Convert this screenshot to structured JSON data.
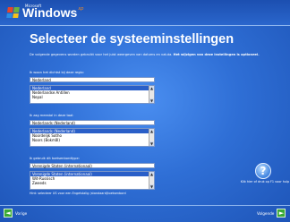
{
  "brand": {
    "ms": "Microsoft",
    "windows": "Windows",
    "xp": "xp"
  },
  "page": {
    "title": "Selecteer de systeeminstellingen",
    "intro_normal": "De volgende gegevens worden gebruikt voor het juist weergeven van datums en valuta.",
    "intro_bold": "Het wijzigen van deze instellingen is optioneel."
  },
  "region": {
    "label": "Ik woon het dichtst bij deze regio:",
    "value": "Nederland",
    "options": [
      "Nederland",
      "Nederlandse Antillen",
      "Nepal"
    ]
  },
  "language": {
    "label": "Ik zag meestal in deze taal:",
    "value": "Nederlands (Nederland)",
    "options": [
      "Nederlands (Nederland)",
      "Noordelijk Sotho",
      "Noors (Bokmål)"
    ]
  },
  "keyboard": {
    "label": "Ik gebruik dit toetsenbordtype:",
    "value": "Verenigde Staten (internationaal)",
    "options": [
      "Verenigde Staten (internationaal)",
      "Wit-Russisch",
      "Zweeds"
    ]
  },
  "hint": "Hint: selecteer US voor een Engelstalig (standaard)toetsenbord",
  "help": {
    "mark": "?",
    "text": "Klik hier of druk op F1 voor hulp"
  },
  "nav": {
    "back_label": "Vorige",
    "next_label": "Volgende",
    "back_arrow": "◄",
    "next_arrow": "►"
  },
  "colors": {
    "background": "#2f72d8",
    "selection": "#2a5fc8",
    "nav_arrow": "#39a935"
  },
  "icons": [
    "windows-flag-icon",
    "help-icon",
    "back-arrow-icon",
    "next-arrow-icon"
  ]
}
